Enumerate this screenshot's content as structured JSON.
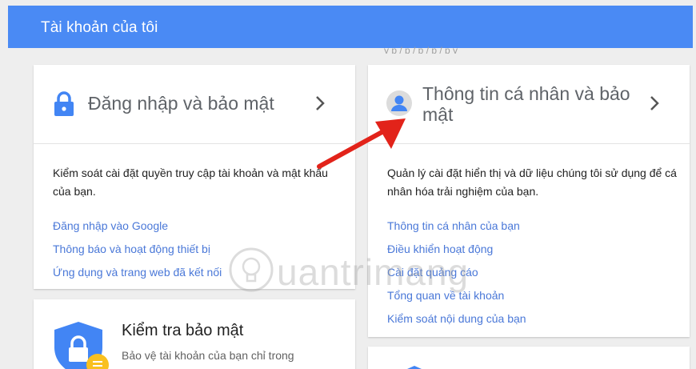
{
  "header": {
    "title": "Tài khoản của tôi"
  },
  "cards": {
    "signin": {
      "title": "Đăng nhập và bảo mật",
      "icon": "lock-icon",
      "description": "Kiểm soát cài đặt quyền truy cập tài khoản và mật khẩu của bạn.",
      "links": [
        "Đăng nhập vào Google",
        "Thông báo và hoạt động thiết bị",
        "Ứng dụng và trang web đã kết nối"
      ]
    },
    "personal": {
      "title": "Thông tin cá nhân và bảo mật",
      "icon": "person-icon",
      "description": "Quản lý cài đặt hiển thị và dữ liệu chúng tôi sử dụng để cá nhân hóa trải nghiệm của bạn.",
      "links": [
        "Thông tin cá nhân của bạn",
        "Điều khiển hoạt động",
        "Cài đặt quảng cáo",
        "Tổng quan về tài khoản",
        "Kiểm soát nội dung của bạn"
      ]
    },
    "security_check": {
      "title": "Kiểm tra bảo mật",
      "description": "Bảo vệ tài khoản của bạn chỉ trong",
      "icon": "shield-lock-icon"
    }
  },
  "watermark": {
    "text": "uantrimang"
  },
  "colors": {
    "header_bg": "#4a8af4",
    "link": "#4a78d8",
    "icon_blue": "#4285f4",
    "arrow": "#e2231a",
    "badge": "#f9c01f"
  }
}
